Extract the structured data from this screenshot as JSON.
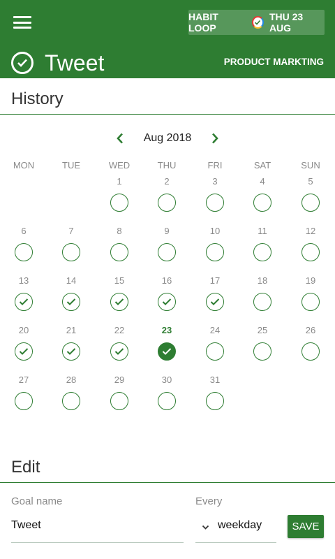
{
  "app": {
    "name": "HABIT LOOP",
    "date": "THU 23 AUG"
  },
  "habit": {
    "title": "Tweet",
    "category": "PRODUCT MARKTING"
  },
  "history": {
    "section_title": "History",
    "month_label": "Aug 2018",
    "weekdays": [
      "MON",
      "TUE",
      "WED",
      "THU",
      "FRI",
      "SAT",
      "SUN"
    ],
    "first_weekday_index": 2,
    "days_in_month": 31,
    "today": 23,
    "completed_days": [
      13,
      14,
      15,
      16,
      17,
      20,
      21,
      22,
      23
    ],
    "accent_color": "#2e7d32"
  },
  "edit": {
    "section_title": "Edit",
    "goal_name_label": "Goal name",
    "goal_name_value": "Tweet",
    "every_label": "Every",
    "every_value": "weekday",
    "save_label": "SAVE"
  },
  "icons": {
    "menu": "menu-icon",
    "title_check": "check-circle-icon",
    "prev": "chevron-left-icon",
    "next": "chevron-right-icon",
    "dropdown": "chevron-down-icon"
  }
}
